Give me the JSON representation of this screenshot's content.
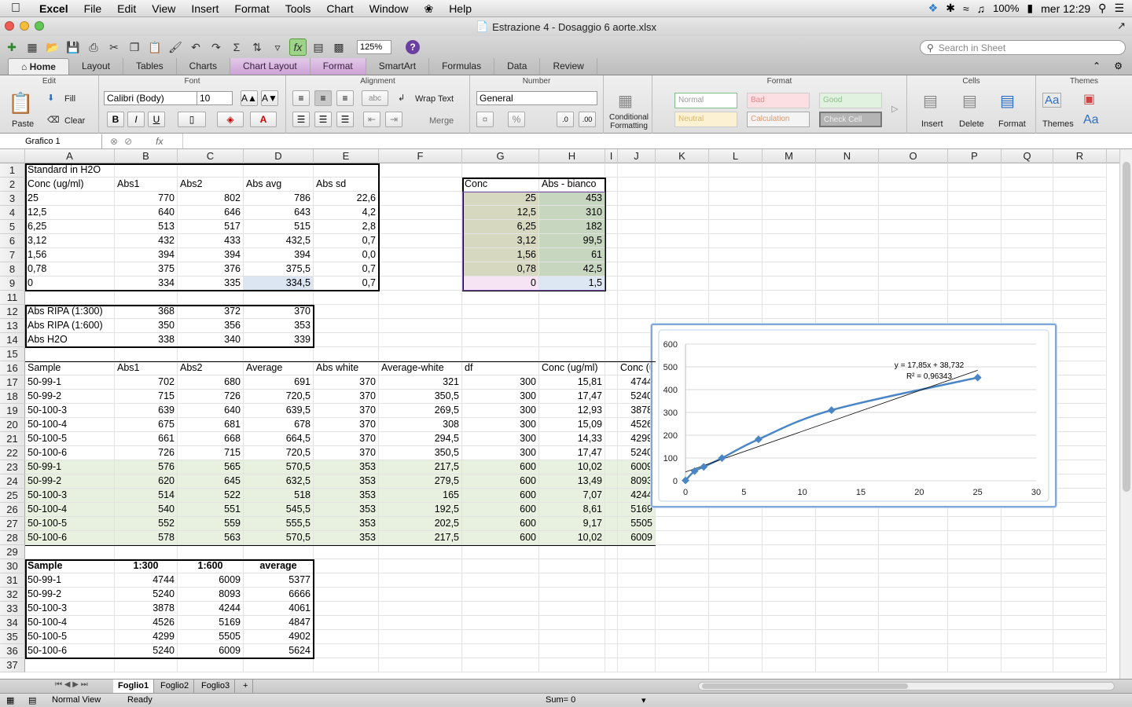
{
  "menubar": {
    "app": "Excel",
    "items": [
      "File",
      "Edit",
      "View",
      "Insert",
      "Format",
      "Tools",
      "Chart",
      "Window",
      "Help"
    ],
    "battery": "100%",
    "clock": "mer 12:29"
  },
  "window": {
    "title": "Estrazione 4 - Dosaggio 6 aorte.xlsx"
  },
  "toolbar": {
    "zoom": "125%",
    "search_placeholder": "Search in Sheet"
  },
  "ribbon": {
    "tabs": [
      "Home",
      "Layout",
      "Tables",
      "Charts",
      "Chart Layout",
      "Format",
      "SmartArt",
      "Formulas",
      "Data",
      "Review"
    ],
    "groups": {
      "edit": "Edit",
      "font": "Font",
      "alignment": "Alignment",
      "number": "Number",
      "format": "Format",
      "cells": "Cells",
      "themes": "Themes"
    },
    "paste": "Paste",
    "fill": "Fill",
    "clear": "Clear",
    "font_name": "Calibri (Body)",
    "font_size": "10",
    "wrap_text": "Wrap Text",
    "merge": "Merge",
    "abc": "abc",
    "number_format": "General",
    "percent": "%",
    "cond_fmt": "Conditional Formatting",
    "styles": [
      "Normal",
      "Bad",
      "Good",
      "Neutral",
      "Calculation",
      "Check Cell"
    ],
    "insert": "Insert",
    "delete": "Delete",
    "format": "Format",
    "themes": "Themes",
    "aa": "Aa"
  },
  "formula_bar": {
    "name_box": "Grafico 1",
    "fx": "fx"
  },
  "columns": [
    "A",
    "B",
    "C",
    "D",
    "E",
    "F",
    "G",
    "H",
    "I",
    "J",
    "K",
    "L",
    "M",
    "N",
    "O",
    "P",
    "Q",
    "R"
  ],
  "rows": [
    {
      "n": "1",
      "cells": {
        "A": "Standard in H2O"
      }
    },
    {
      "n": "2",
      "cells": {
        "A": "Conc (ug/ml)",
        "B": "Abs1",
        "C": "Abs2",
        "D": "Abs avg",
        "E": "Abs sd",
        "G": "Conc",
        "H": "Abs - bianco"
      }
    },
    {
      "n": "3",
      "cells": {
        "A": "25",
        "B": "770",
        "C": "802",
        "D": "786",
        "E": "22,6",
        "G": "25",
        "H": "453"
      }
    },
    {
      "n": "4",
      "cells": {
        "A": "12,5",
        "B": "640",
        "C": "646",
        "D": "643",
        "E": "4,2",
        "G": "12,5",
        "H": "310"
      }
    },
    {
      "n": "5",
      "cells": {
        "A": "6,25",
        "B": "513",
        "C": "517",
        "D": "515",
        "E": "2,8",
        "G": "6,25",
        "H": "182"
      }
    },
    {
      "n": "6",
      "cells": {
        "A": "3,12",
        "B": "432",
        "C": "433",
        "D": "432,5",
        "E": "0,7",
        "G": "3,12",
        "H": "99,5"
      }
    },
    {
      "n": "7",
      "cells": {
        "A": "1,56",
        "B": "394",
        "C": "394",
        "D": "394",
        "E": "0,0",
        "G": "1,56",
        "H": "61"
      }
    },
    {
      "n": "8",
      "cells": {
        "A": "0,78",
        "B": "375",
        "C": "376",
        "D": "375,5",
        "E": "0,7",
        "G": "0,78",
        "H": "42,5"
      }
    },
    {
      "n": "9",
      "cells": {
        "A": "0",
        "B": "334",
        "C": "335",
        "D": "334,5",
        "E": "0,7",
        "G": "0",
        "H": "1,5"
      }
    },
    {
      "n": "11",
      "cells": {}
    },
    {
      "n": "12",
      "cells": {
        "A": "Abs RIPA (1:300)",
        "B": "368",
        "C": "372",
        "D": "370"
      }
    },
    {
      "n": "13",
      "cells": {
        "A": "Abs RIPA (1:600)",
        "B": "350",
        "C": "356",
        "D": "353"
      }
    },
    {
      "n": "14",
      "cells": {
        "A": "Abs H2O",
        "B": "338",
        "C": "340",
        "D": "339"
      }
    },
    {
      "n": "15",
      "cells": {}
    },
    {
      "n": "16",
      "cells": {
        "A": "Sample",
        "B": "Abs1",
        "C": "Abs2",
        "D": "Average",
        "E": "Abs white",
        "F": "Average-white",
        "G": "df",
        "H": "Conc (ug/ml)",
        "J": "Conc (ug/ml)"
      }
    },
    {
      "n": "17",
      "cells": {
        "A": "50-99-1",
        "B": "702",
        "C": "680",
        "D": "691",
        "E": "370",
        "F": "321",
        "G": "300",
        "H": "15,81",
        "J": "4744"
      }
    },
    {
      "n": "18",
      "cells": {
        "A": "50-99-2",
        "B": "715",
        "C": "726",
        "D": "720,5",
        "E": "370",
        "F": "350,5",
        "G": "300",
        "H": "17,47",
        "J": "5240"
      }
    },
    {
      "n": "19",
      "cells": {
        "A": "50-100-3",
        "B": "639",
        "C": "640",
        "D": "639,5",
        "E": "370",
        "F": "269,5",
        "G": "300",
        "H": "12,93",
        "J": "3878"
      }
    },
    {
      "n": "20",
      "cells": {
        "A": "50-100-4",
        "B": "675",
        "C": "681",
        "D": "678",
        "E": "370",
        "F": "308",
        "G": "300",
        "H": "15,09",
        "J": "4526"
      }
    },
    {
      "n": "21",
      "cells": {
        "A": "50-100-5",
        "B": "661",
        "C": "668",
        "D": "664,5",
        "E": "370",
        "F": "294,5",
        "G": "300",
        "H": "14,33",
        "J": "4299"
      }
    },
    {
      "n": "22",
      "cells": {
        "A": "50-100-6",
        "B": "726",
        "C": "715",
        "D": "720,5",
        "E": "370",
        "F": "350,5",
        "G": "300",
        "H": "17,47",
        "J": "5240"
      }
    },
    {
      "n": "23",
      "cells": {
        "A": "50-99-1",
        "B": "576",
        "C": "565",
        "D": "570,5",
        "E": "353",
        "F": "217,5",
        "G": "600",
        "H": "10,02",
        "J": "6009"
      }
    },
    {
      "n": "24",
      "cells": {
        "A": "50-99-2",
        "B": "620",
        "C": "645",
        "D": "632,5",
        "E": "353",
        "F": "279,5",
        "G": "600",
        "H": "13,49",
        "J": "8093"
      }
    },
    {
      "n": "25",
      "cells": {
        "A": "50-100-3",
        "B": "514",
        "C": "522",
        "D": "518",
        "E": "353",
        "F": "165",
        "G": "600",
        "H": "7,07",
        "J": "4244"
      }
    },
    {
      "n": "26",
      "cells": {
        "A": "50-100-4",
        "B": "540",
        "C": "551",
        "D": "545,5",
        "E": "353",
        "F": "192,5",
        "G": "600",
        "H": "8,61",
        "J": "5169"
      }
    },
    {
      "n": "27",
      "cells": {
        "A": "50-100-5",
        "B": "552",
        "C": "559",
        "D": "555,5",
        "E": "353",
        "F": "202,5",
        "G": "600",
        "H": "9,17",
        "J": "5505"
      }
    },
    {
      "n": "28",
      "cells": {
        "A": "50-100-6",
        "B": "578",
        "C": "563",
        "D": "570,5",
        "E": "353",
        "F": "217,5",
        "G": "600",
        "H": "10,02",
        "J": "6009"
      }
    },
    {
      "n": "29",
      "cells": {}
    },
    {
      "n": "30",
      "cells": {
        "A": "Sample",
        "B": "1:300",
        "C": "1:600",
        "D": "average"
      }
    },
    {
      "n": "31",
      "cells": {
        "A": "50-99-1",
        "B": "4744",
        "C": "6009",
        "D": "5377"
      }
    },
    {
      "n": "32",
      "cells": {
        "A": "50-99-2",
        "B": "5240",
        "C": "8093",
        "D": "6666"
      }
    },
    {
      "n": "33",
      "cells": {
        "A": "50-100-3",
        "B": "3878",
        "C": "4244",
        "D": "4061"
      }
    },
    {
      "n": "34",
      "cells": {
        "A": "50-100-4",
        "B": "4526",
        "C": "5169",
        "D": "4847"
      }
    },
    {
      "n": "35",
      "cells": {
        "A": "50-100-5",
        "B": "4299",
        "C": "5505",
        "D": "4902"
      }
    },
    {
      "n": "36",
      "cells": {
        "A": "50-100-6",
        "B": "5240",
        "C": "6009",
        "D": "5624"
      }
    },
    {
      "n": "37",
      "cells": {}
    }
  ],
  "chart_data": {
    "type": "scatter",
    "x": [
      0,
      0.78,
      1.56,
      3.12,
      6.25,
      12.5,
      25
    ],
    "y": [
      1.5,
      42.5,
      61,
      99.5,
      182,
      310,
      453
    ],
    "xlim": [
      0,
      30
    ],
    "ylim": [
      0,
      600
    ],
    "xticks": [
      "0",
      "5",
      "10",
      "15",
      "20",
      "25",
      "30"
    ],
    "yticks": [
      "0",
      "100",
      "200",
      "300",
      "400",
      "500",
      "600"
    ],
    "trendline": {
      "slope": 17.85,
      "intercept": 38.732
    },
    "equation": "y = 17,85x + 38,732",
    "r2": "R² = 0,96343",
    "grid": "horizontal",
    "series_color": "#4a86c5"
  },
  "sheets": [
    "Foglio1",
    "Foglio2",
    "Foglio3",
    "+"
  ],
  "status": {
    "view": "Normal View",
    "state": "Ready",
    "sum": "Sum= 0"
  }
}
